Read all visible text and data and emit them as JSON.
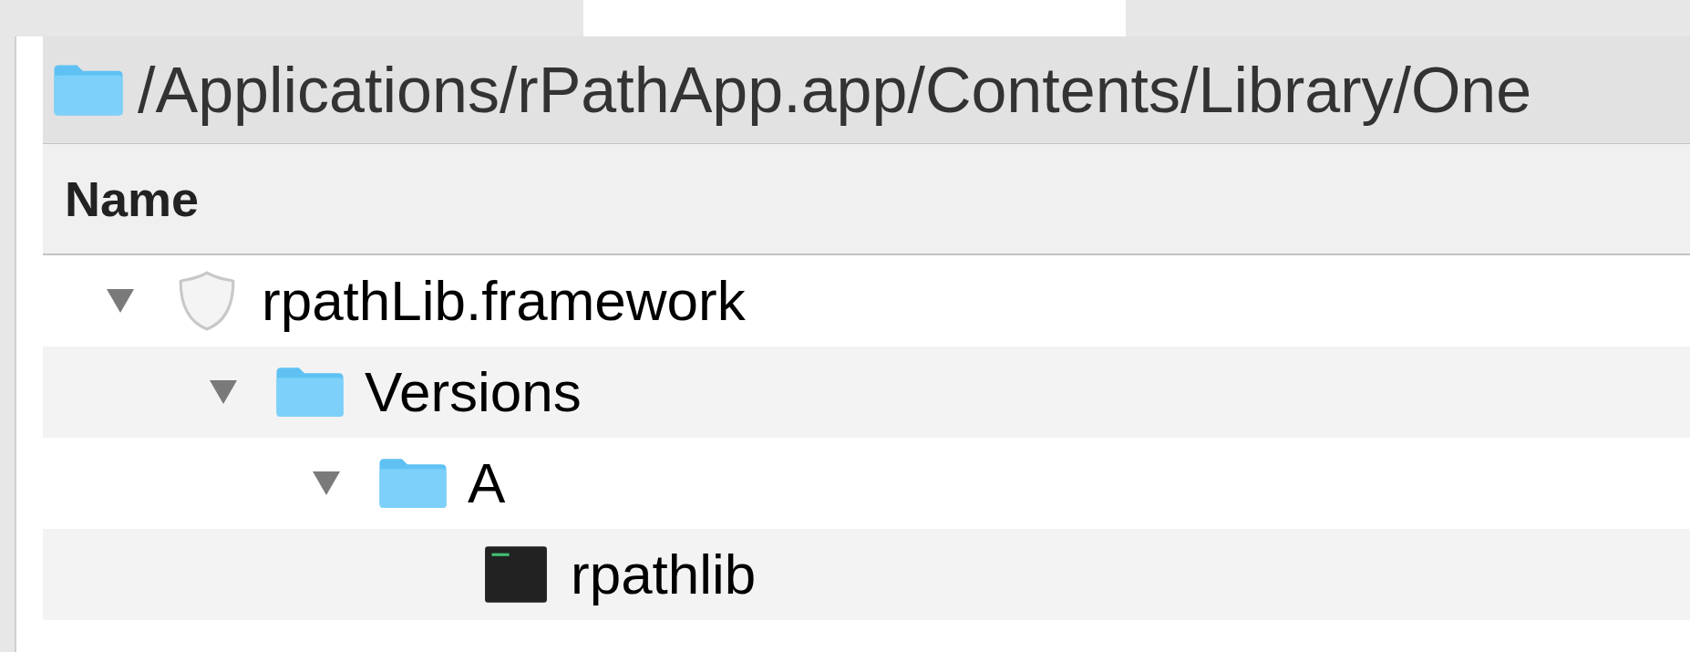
{
  "path_bar": {
    "path": "/Applications/rPathApp.app/Contents/Library/One"
  },
  "columns": [
    {
      "label": "Name"
    }
  ],
  "tree": [
    {
      "name": "rpathLib.framework",
      "kind": "framework",
      "expanded": true,
      "children": [
        {
          "name": "Versions",
          "kind": "folder",
          "expanded": true,
          "children": [
            {
              "name": "A",
              "kind": "folder",
              "expanded": true,
              "children": [
                {
                  "name": "rpathlib",
                  "kind": "executable"
                }
              ]
            }
          ]
        }
      ]
    }
  ]
}
